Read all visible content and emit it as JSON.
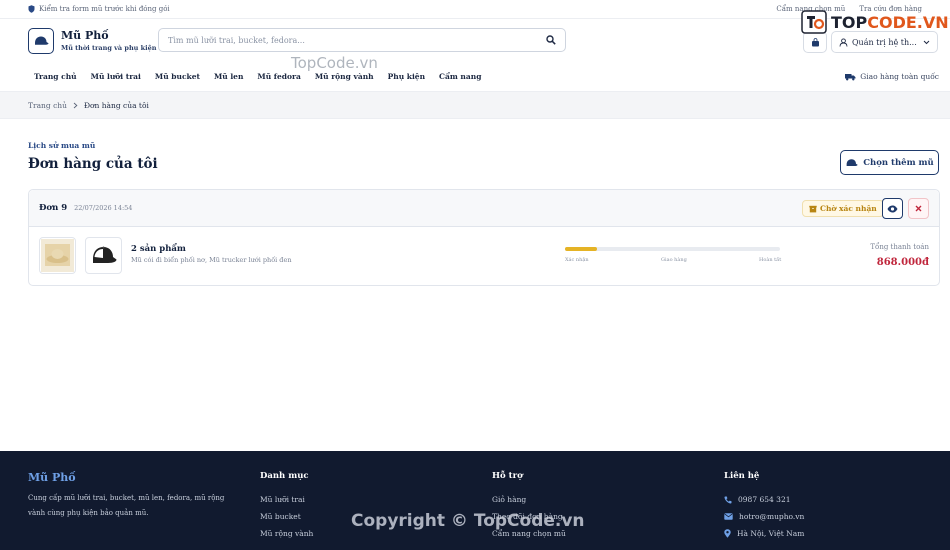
{
  "topbar": {
    "notice": "Kiểm tra form mũ trước khi đóng gói",
    "links": [
      "Cẩm nang chọn mũ",
      "Tra cứu đơn hàng"
    ]
  },
  "header": {
    "brand_name": "Mũ Phố",
    "brand_tagline": "Mũ thời trang và phụ kiện",
    "search_placeholder": "Tìm mũ lưỡi trai, bucket, fedora...",
    "account_label": "Quản trị hệ th..."
  },
  "nav": {
    "items": [
      "Trang chủ",
      "Mũ lưỡi trai",
      "Mũ bucket",
      "Mũ len",
      "Mũ fedora",
      "Mũ rộng vành",
      "Phụ kiện",
      "Cẩm nang"
    ],
    "shipping": "Giao hàng toàn quốc"
  },
  "breadcrumb": {
    "home": "Trang chủ",
    "current": "Đơn hàng của tôi"
  },
  "page": {
    "overline": "Lịch sử mua mũ",
    "title": "Đơn hàng của tôi",
    "choose_button": "Chọn thêm mũ"
  },
  "order": {
    "id": "Đơn 9",
    "date": "22/07/2026 14:54",
    "status": "Chờ xác nhận",
    "items_count": "2 sản phẩm",
    "items_desc": "Mũ cói đi biển phối nơ, Mũ trucker lưới phối đen",
    "progress": 0.15,
    "steps": [
      "Xác nhận",
      "Giao hàng",
      "Hoàn tất"
    ],
    "total_label": "Tổng thanh toán",
    "total_value": "868.000đ"
  },
  "footer": {
    "brand": "Mũ Phố",
    "desc": "Cung cấp mũ lưỡi trai, bucket, mũ len, fedora, mũ rộng vành cùng phụ kiện bảo quản mũ.",
    "categories_title": "Danh mục",
    "categories": [
      "Mũ lưỡi trai",
      "Mũ bucket",
      "Mũ rộng vành"
    ],
    "support_title": "Hỗ trợ",
    "support": [
      "Giỏ hàng",
      "Theo dõi đơn hàng",
      "Cẩm nang chọn mũ"
    ],
    "contact_title": "Liên hệ",
    "contact": [
      "0987 654 321",
      "hotro@mupho.vn",
      "Hà Nội, Việt Nam"
    ]
  },
  "watermarks": {
    "logo_prefix": "TOP",
    "logo_suffix": "CODE.VN",
    "center": "TopCode.vn",
    "bottom": "Copyright © TopCode.vn"
  },
  "colors": {
    "primary": "#1f3a6b",
    "accent_gold": "#e5b325",
    "price_red": "#c0263c",
    "footer_bg": "#111a2f"
  }
}
